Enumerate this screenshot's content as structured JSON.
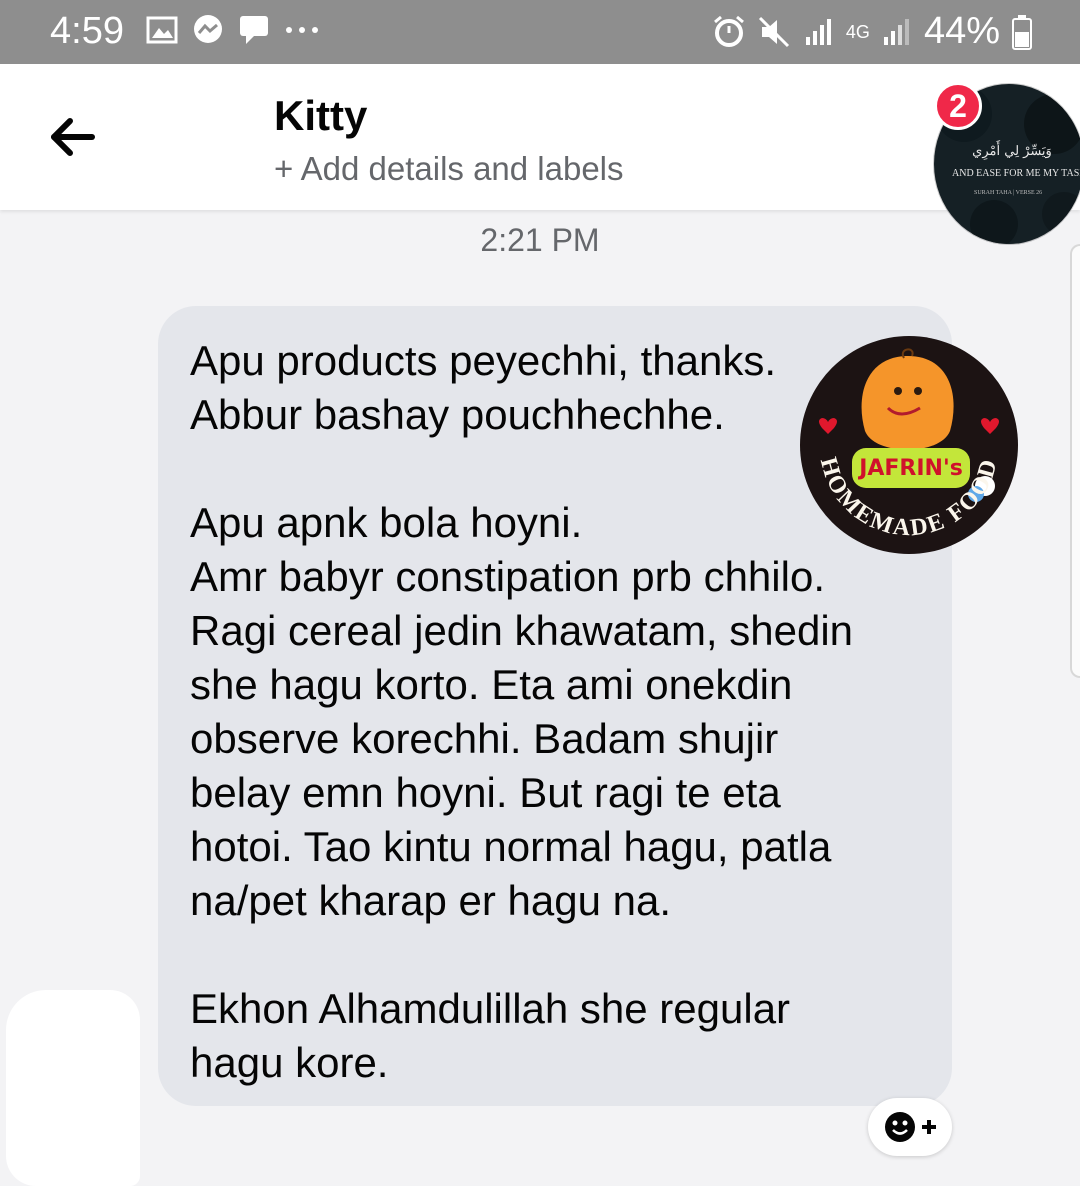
{
  "status_bar": {
    "time": "4:59",
    "network": "4G",
    "battery": "44%",
    "left_icons": [
      "image-icon",
      "messenger-icon",
      "chat-icon",
      "more-dots-icon"
    ],
    "right_icons": [
      "alarm-icon",
      "mute-icon",
      "signal-icon",
      "signal-icon",
      "battery-icon"
    ]
  },
  "header": {
    "title": "Kitty",
    "subtitle": "+ Add details and labels",
    "badge_count": "2",
    "avatar_text_arabic": "وَيَسِّرْ لِي أَمْرِي",
    "avatar_text": "AND EASE FOR ME MY TASK",
    "avatar_caption": "SURAH TAHA | VERSE 26"
  },
  "conversation": {
    "timestamp": "2:21 PM",
    "message": "Apu products peyechhi, thanks.\nAbbur bashay pouchhechhe.\n\nApu apnk bola hoyni.\nAmr babyr constipation prb chhilo.\nRagi cereal jedin khawatam, shedin\nshe hagu korto. Eta ami onekdin\nobserve korechhi. Badam shujir\nbelay emn hoyni. But ragi te eta\nhotoi. Tao kintu normal hagu, patla\nna/pet kharap er hagu na.\n\nEkhon Alhamdulillah she regular\nhagu kore."
  },
  "sticker": {
    "name": "JAFRIN's",
    "ring_text": "HOMEMADE FOOD"
  },
  "colors": {
    "status_bar": "#8e8e8e",
    "bubble": "#e4e6eb",
    "badge": "#f02849",
    "background": "#f3f3f5"
  }
}
